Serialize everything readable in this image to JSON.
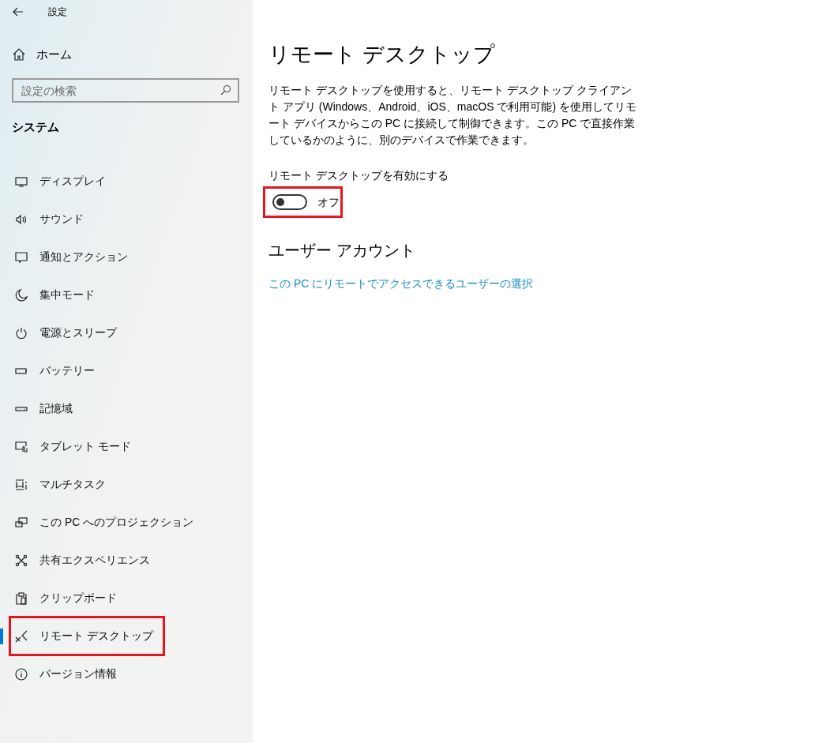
{
  "window": {
    "title": "設定"
  },
  "sidebar": {
    "home": {
      "label": "ホーム"
    },
    "search": {
      "placeholder": "設定の検索"
    },
    "section": "システム",
    "items": [
      {
        "label": "ディスプレイ",
        "kind": "display",
        "selected": false,
        "highlighted": false
      },
      {
        "label": "サウンド",
        "kind": "sound",
        "selected": false,
        "highlighted": false
      },
      {
        "label": "通知とアクション",
        "kind": "notification",
        "selected": false,
        "highlighted": false
      },
      {
        "label": "集中モード",
        "kind": "moon",
        "selected": false,
        "highlighted": false
      },
      {
        "label": "電源とスリープ",
        "kind": "power",
        "selected": false,
        "highlighted": false
      },
      {
        "label": "バッテリー",
        "kind": "battery",
        "selected": false,
        "highlighted": false
      },
      {
        "label": "記憶域",
        "kind": "storage",
        "selected": false,
        "highlighted": false
      },
      {
        "label": "タブレット モード",
        "kind": "tablet",
        "selected": false,
        "highlighted": false
      },
      {
        "label": "マルチタスク",
        "kind": "multitask",
        "selected": false,
        "highlighted": false
      },
      {
        "label": "この PC へのプロジェクション",
        "kind": "projection",
        "selected": false,
        "highlighted": false
      },
      {
        "label": "共有エクスペリエンス",
        "kind": "shared",
        "selected": false,
        "highlighted": false
      },
      {
        "label": "クリップボード",
        "kind": "clipboard",
        "selected": false,
        "highlighted": false
      },
      {
        "label": "リモート デスクトップ",
        "kind": "remote",
        "selected": true,
        "highlighted": true
      },
      {
        "label": "バージョン情報",
        "kind": "info",
        "selected": false,
        "highlighted": false
      }
    ]
  },
  "main": {
    "title": "リモート デスクトップ",
    "description": "リモート デスクトップを使用すると、リモート デスクトップ クライアント アプリ (Windows、Android、iOS、macOS で利用可能) を使用してリモート デバイスからこの PC に接続して制御できます。この PC で直接作業しているかのように、別のデバイスで作業できます。",
    "toggle": {
      "label": "リモート デスクトップを有効にする",
      "on": false,
      "state_text": "オフ",
      "highlighted": true
    },
    "section": "ユーザー アカウント",
    "link": "この PC にリモートでアクセスできるユーザーの選択"
  }
}
